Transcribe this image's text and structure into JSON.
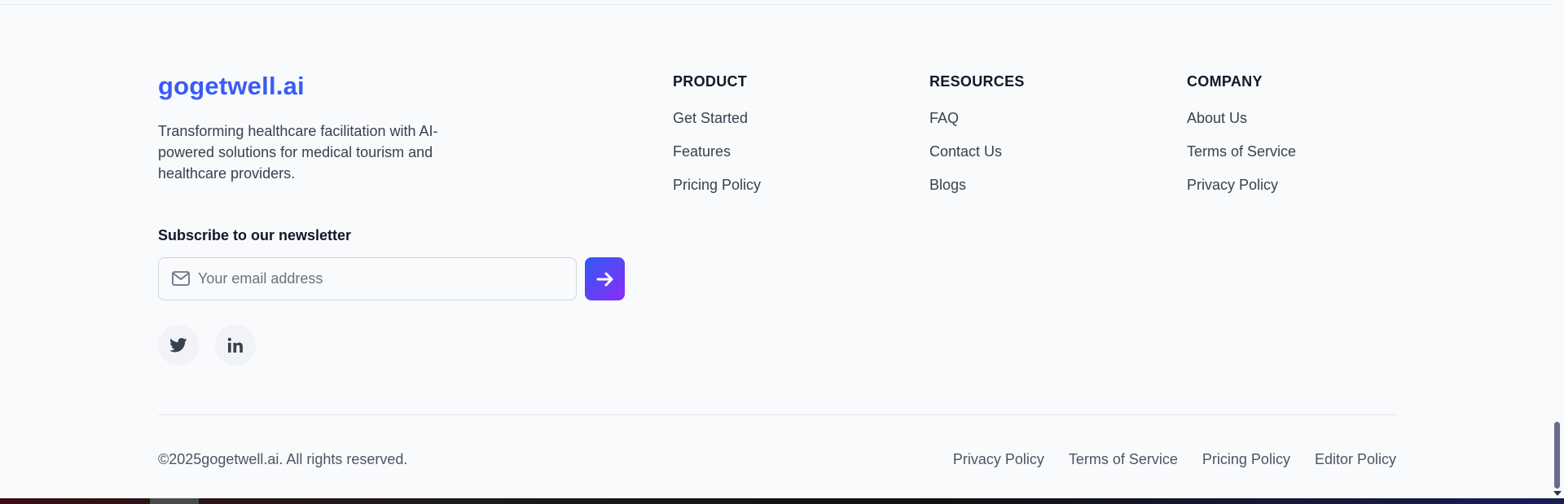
{
  "brand": {
    "name": "gogetwell.ai",
    "tagline": "Transforming healthcare facilitation with AI-powered solutions for medical tourism and healthcare providers."
  },
  "newsletter": {
    "title": "Subscribe to our newsletter",
    "email_placeholder": "Your email address",
    "email_value": "",
    "submit_icon": "arrow-right-icon",
    "input_icon": "mail-icon"
  },
  "social": [
    {
      "icon": "twitter-icon"
    },
    {
      "icon": "linkedin-icon"
    }
  ],
  "columns": [
    {
      "title": "PRODUCT",
      "links": [
        "Get Started",
        "Features",
        "Pricing Policy"
      ]
    },
    {
      "title": "RESOURCES",
      "links": [
        "FAQ",
        "Contact Us",
        "Blogs"
      ]
    },
    {
      "title": "COMPANY",
      "links": [
        "About Us",
        "Terms of Service",
        "Privacy Policy"
      ]
    }
  ],
  "bottom": {
    "copyright": "©2025gogetwell.ai. All rights reserved.",
    "links": [
      "Privacy Policy",
      "Terms of Service",
      "Pricing Policy",
      "Editor Policy"
    ]
  },
  "colors": {
    "brand": "#3b5bf5",
    "button_gradient_start": "#2f5bf5",
    "button_gradient_end": "#8b2cf5",
    "background": "#f8fafc"
  }
}
